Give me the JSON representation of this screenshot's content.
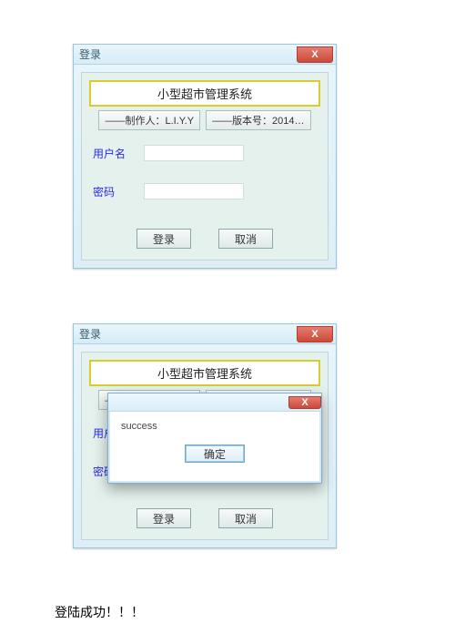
{
  "login_window": {
    "title": "登录",
    "header": "小型超市管理系统",
    "author_label": "——制作人：L.I.Y.Y",
    "version_label": "——版本号：2014…",
    "username_label": "用户名",
    "password_label": "密码",
    "username_value": "",
    "password_value": "",
    "login_btn": "登录",
    "cancel_btn": "取消",
    "close_glyph": "X"
  },
  "login_window2": {
    "password_value": "●●●●●●"
  },
  "modal": {
    "message": "success",
    "ok_btn": "确定",
    "close_glyph": "X"
  },
  "caption": "登陆成功！！！"
}
